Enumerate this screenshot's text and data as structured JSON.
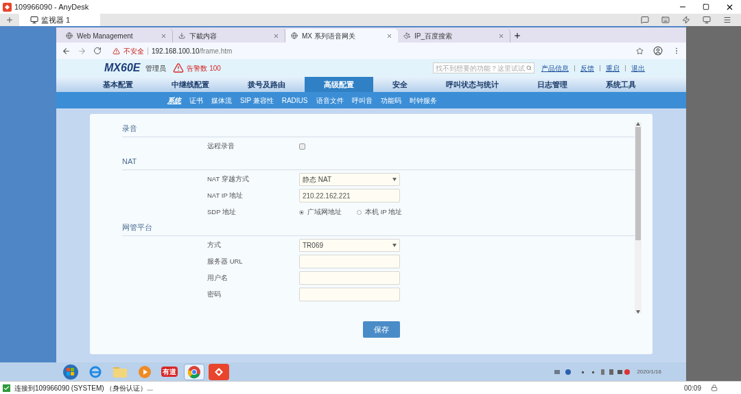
{
  "anydesk": {
    "title": "109966090 - AnyDesk",
    "session_tab": {
      "label": "监视器 1",
      "selected": true
    },
    "status": {
      "text": "连接到109966090 (SYSTEM) （身份认证）...",
      "time": "00:09"
    }
  },
  "browser": {
    "tabs": [
      {
        "title": "Web Management",
        "kind": "web",
        "selected": false
      },
      {
        "title": "下載内容",
        "kind": "downloads",
        "selected": false
      },
      {
        "title": "MX 系列语音网关",
        "kind": "web",
        "selected": true
      },
      {
        "title": "IP_百度搜索",
        "kind": "search",
        "selected": false
      }
    ],
    "address": {
      "security": "不安全",
      "host": "192.168.100.10",
      "path": "/frame.htm"
    }
  },
  "page": {
    "brand": "MX60E",
    "role": "管理员",
    "alarm": "告警数 100",
    "search_placeholder": "找不到想要的功能？这里试试",
    "links": [
      "产品信息",
      "反馈",
      "重启",
      "退出"
    ],
    "nav": [
      {
        "label": "基本配置",
        "selected": false
      },
      {
        "label": "中继线配置",
        "selected": false
      },
      {
        "label": "拨号及路由",
        "selected": false
      },
      {
        "label": "高级配置",
        "selected": true
      },
      {
        "label": "安全",
        "selected": false
      },
      {
        "label": "呼叫状态与统计",
        "selected": false
      },
      {
        "label": "日志管理",
        "selected": false
      },
      {
        "label": "系统工具",
        "selected": false
      }
    ],
    "subnav": [
      {
        "label": "系统",
        "selected": true
      },
      {
        "label": "证书",
        "selected": false
      },
      {
        "label": "媒体流",
        "selected": false
      },
      {
        "label": "SIP 兼容性",
        "selected": false
      },
      {
        "label": "RADIUS",
        "selected": false
      },
      {
        "label": "语音文件",
        "selected": false
      },
      {
        "label": "呼叫音",
        "selected": false
      },
      {
        "label": "功能码",
        "selected": false
      },
      {
        "label": "时钟服务",
        "selected": false
      }
    ],
    "sections": [
      {
        "title": "录音",
        "rows": [
          {
            "kind": "checkbox",
            "label": "远程录音",
            "checked": false
          }
        ]
      },
      {
        "title": "NAT",
        "rows": [
          {
            "kind": "select",
            "label": "NAT 穿越方式",
            "value": "静态 NAT"
          },
          {
            "kind": "input",
            "label": "NAT IP 地址",
            "value": "210.22.162.221"
          },
          {
            "kind": "radio",
            "label": "SDP 地址",
            "options": [
              {
                "label": "广域网地址",
                "selected": true
              },
              {
                "label": "本机 IP 地址",
                "selected": false
              }
            ]
          }
        ]
      },
      {
        "title": "网管平台",
        "rows": [
          {
            "kind": "select",
            "label": "方式",
            "value": "TR069"
          },
          {
            "kind": "input",
            "label": "服务器 URL",
            "value": ""
          },
          {
            "kind": "input",
            "label": "用户名",
            "value": ""
          },
          {
            "kind": "input",
            "label": "密码",
            "value": ""
          }
        ]
      }
    ],
    "save": "保存"
  },
  "taskbar": {
    "apps": [
      {
        "kind": "start",
        "selected": false
      },
      {
        "kind": "ie",
        "selected": false
      },
      {
        "kind": "folder",
        "selected": false
      },
      {
        "kind": "media",
        "selected": false
      },
      {
        "kind": "youdao",
        "label": "有道",
        "selected": false
      },
      {
        "kind": "chrome",
        "selected": true
      },
      {
        "kind": "anydesk",
        "selected": false
      }
    ],
    "date": "2020/1/16"
  }
}
